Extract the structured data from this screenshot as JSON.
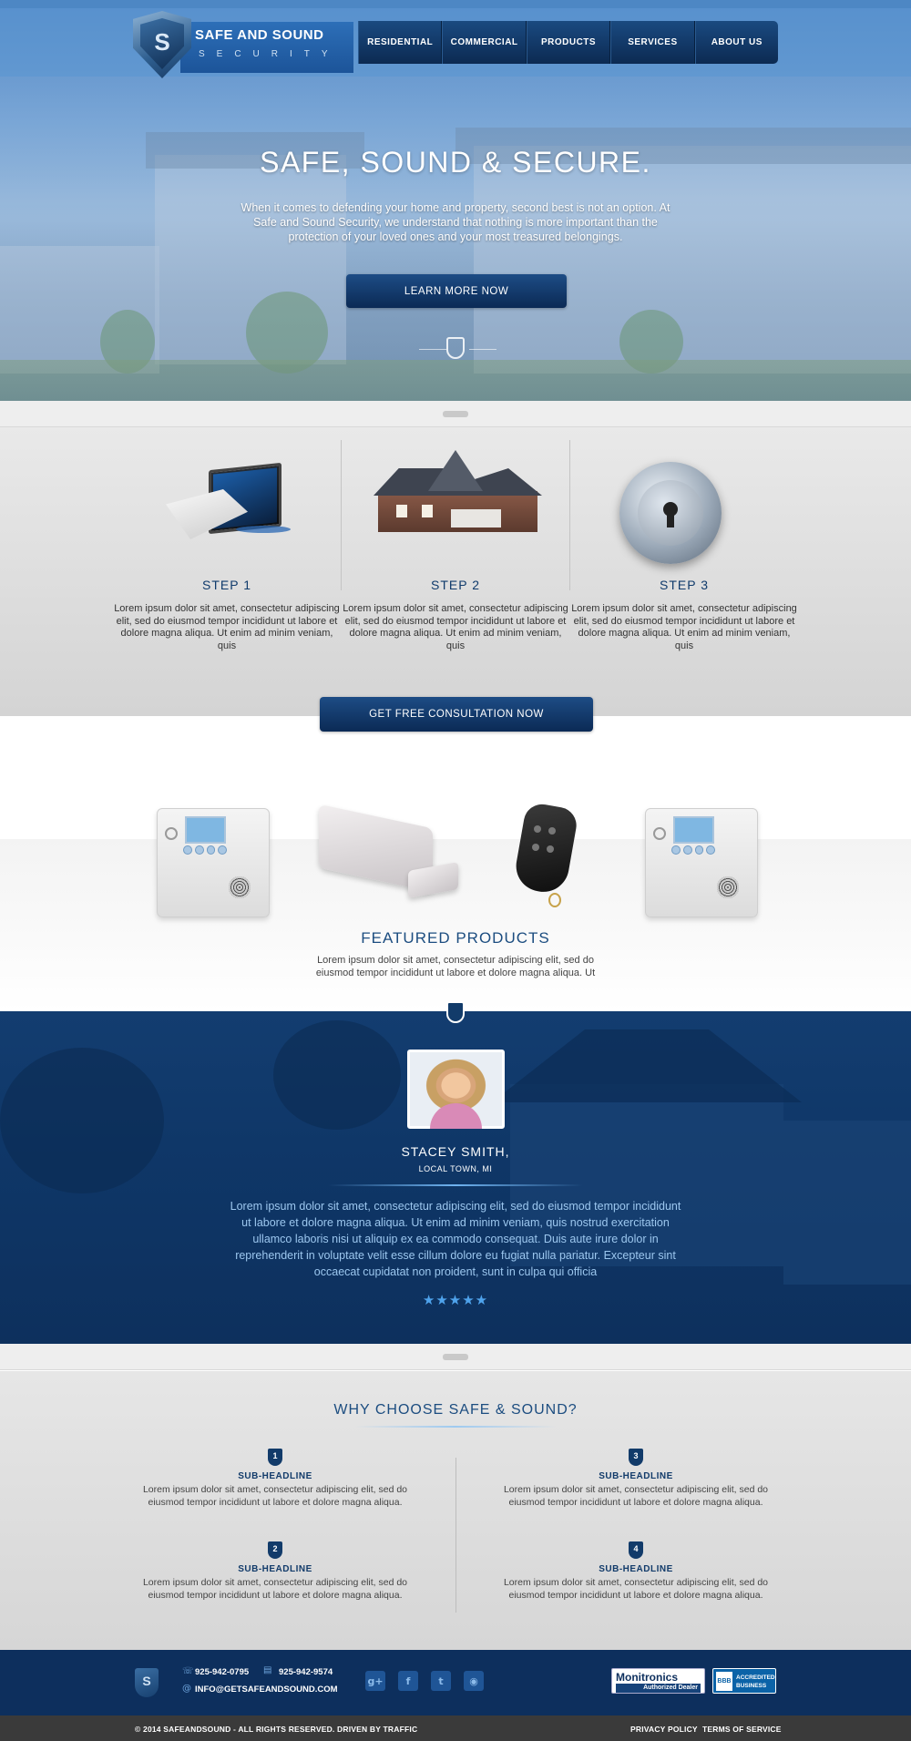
{
  "brand": {
    "name": "SAFE AND SOUND",
    "tagline": "SECURITY",
    "monogram": "S"
  },
  "nav": {
    "items": [
      {
        "label": "RESIDENTIAL"
      },
      {
        "label": "COMMERCIAL"
      },
      {
        "label": "PRODUCTS"
      },
      {
        "label": "SERVICES"
      },
      {
        "label": "ABOUT US"
      }
    ]
  },
  "hero": {
    "title": "SAFE, SOUND & SECURE.",
    "text": "When it comes to defending your home and property, second best is not an option. At Safe and Sound Security, we understand that nothing is more important than the protection of your loved ones and your most treasured belongings.",
    "button": "LEARN MORE NOW"
  },
  "steps": {
    "items": [
      {
        "title": "STEP 1",
        "icon": "envelope-monitor-icon",
        "text": "Lorem ipsum dolor sit amet, consectetur adipiscing elit, sed do eiusmod tempor incididunt ut labore et dolore magna aliqua. Ut enim ad minim veniam, quis"
      },
      {
        "title": "STEP 2",
        "icon": "house-icon",
        "text": "Lorem ipsum dolor sit amet, consectetur adipiscing elit, sed do eiusmod tempor incididunt ut labore et dolore magna aliqua. Ut enim ad minim veniam, quis"
      },
      {
        "title": "STEP 3",
        "icon": "lock-cylinder-icon",
        "text": "Lorem ipsum dolor sit amet, consectetur adipiscing elit, sed do eiusmod tempor incididunt ut labore et dolore magna aliqua. Ut enim ad minim veniam, quis"
      }
    ],
    "button": "GET FREE CONSULTATION NOW"
  },
  "products": {
    "title": "FEATURED PRODUCTS",
    "text": "Lorem ipsum dolor sit amet, consectetur adipiscing elit, sed do eiusmod tempor incididunt ut labore et dolore magna aliqua. Ut",
    "items": [
      "alarm-panel",
      "door-sensor",
      "key-fob",
      "alarm-panel"
    ]
  },
  "testimonial": {
    "name": "STACEY SMITH,",
    "location": "LOCAL TOWN, MI",
    "quote": "Lorem ipsum dolor sit amet, consectetur adipiscing elit, sed do eiusmod tempor incididunt ut labore et dolore magna aliqua. Ut enim ad minim veniam, quis nostrud exercitation ullamco laboris nisi ut aliquip ex ea commodo consequat. Duis aute irure dolor in reprehenderit in voluptate velit esse cillum dolore eu fugiat nulla pariatur. Excepteur sint occaecat cupidatat non proident, sunt in culpa qui officia",
    "rating": 4.5,
    "stars": "★★★★★"
  },
  "why": {
    "title": "WHY CHOOSE SAFE & SOUND?",
    "items": [
      {
        "num": "1",
        "title": "SUB-HEADLINE",
        "text": "Lorem ipsum dolor sit amet, consectetur adipiscing elit, sed do eiusmod tempor incididunt ut labore et dolore magna aliqua."
      },
      {
        "num": "2",
        "title": "SUB-HEADLINE",
        "text": "Lorem ipsum dolor sit amet, consectetur adipiscing elit, sed do eiusmod tempor incididunt ut labore et dolore magna aliqua."
      },
      {
        "num": "3",
        "title": "SUB-HEADLINE",
        "text": "Lorem ipsum dolor sit amet, consectetur adipiscing elit, sed do eiusmod tempor incididunt ut labore et dolore magna aliqua."
      },
      {
        "num": "4",
        "title": "SUB-HEADLINE",
        "text": "Lorem ipsum dolor sit amet, consectetur adipiscing elit, sed do eiusmod tempor incididunt ut labore et dolore magna aliqua."
      }
    ]
  },
  "footer": {
    "phone": "925-942-0795",
    "fax": "925-942-9574",
    "email": "INFO@GETSAFEANDSOUND.COM",
    "social": [
      {
        "name": "google-plus-icon",
        "glyph": "g+"
      },
      {
        "name": "facebook-icon",
        "glyph": "f"
      },
      {
        "name": "twitter-icon",
        "glyph": "t"
      },
      {
        "name": "rss-icon",
        "glyph": "◉"
      }
    ],
    "badge_monitronics": "Monitronics",
    "badge_monitronics_sub": "Authorized Dealer",
    "badge_bbb_logo": "BBB",
    "badge_bbb_line1": "ACCREDITED",
    "badge_bbb_line2": "BUSINESS",
    "copyright": "© 2014 SAFEANDSOUND - ALL RIGHTS RESERVED. DRIVEN BY TRAFFIC",
    "privacy": "PRIVACY POLICY",
    "terms": "TERMS OF SERVICE"
  },
  "colors": {
    "navy": "#0d2f5d",
    "accent": "#1c4d80",
    "star": "#4fa3ec"
  }
}
